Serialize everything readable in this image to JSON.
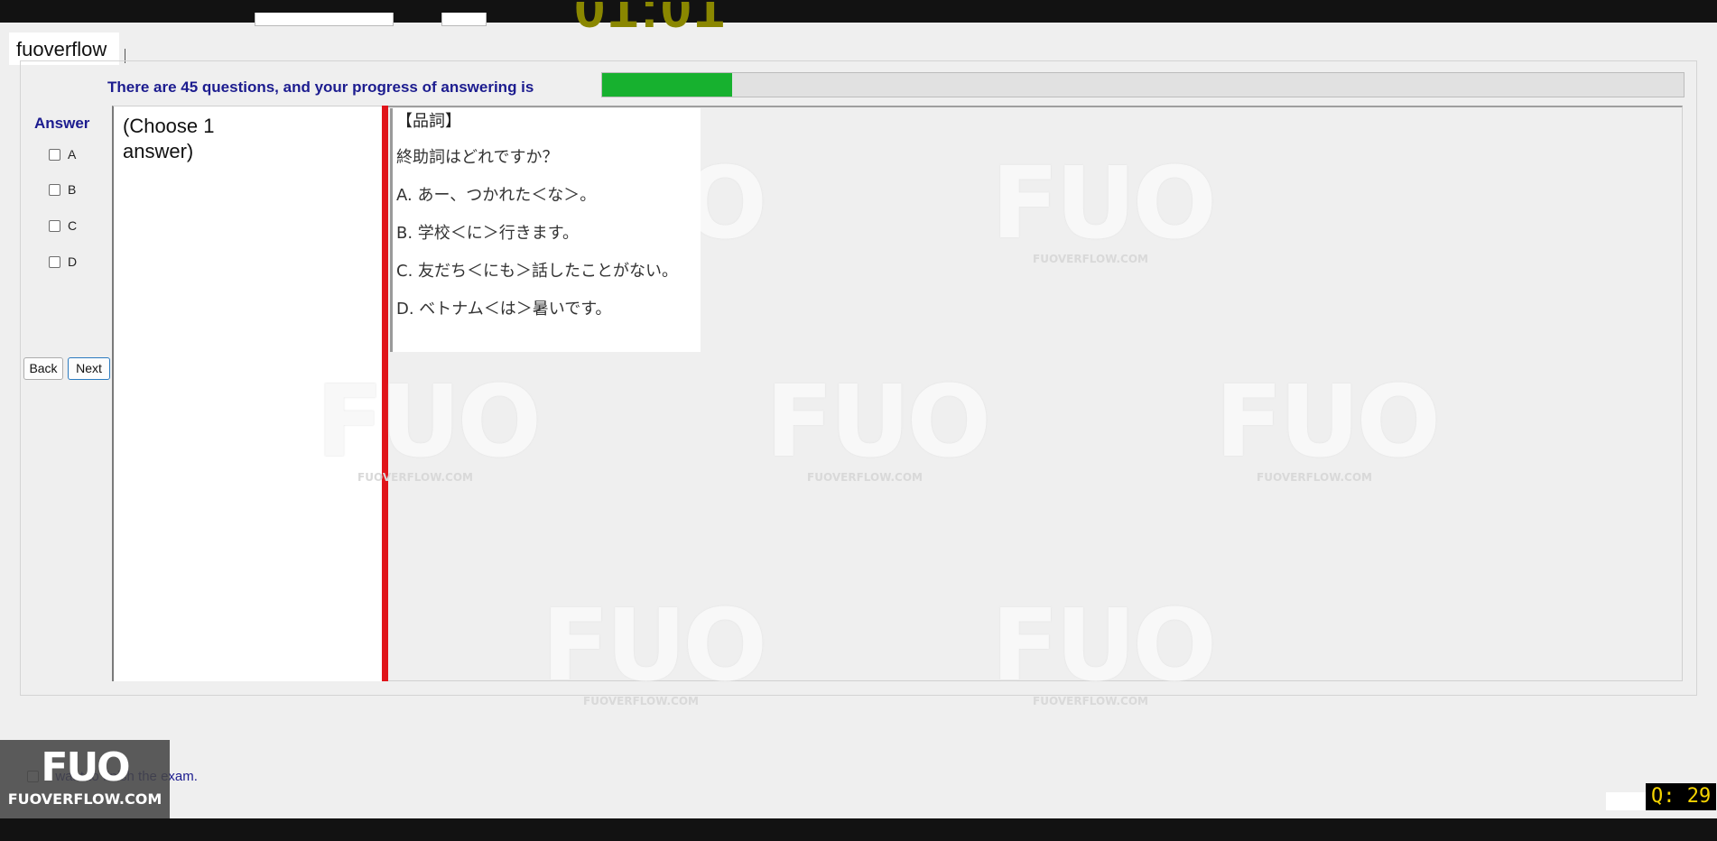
{
  "header": {
    "username": "fuoverflow"
  },
  "progress": {
    "text": "There are 45 questions, and your progress of answering is",
    "fraction": 0.12
  },
  "answer_panel": {
    "title": "Answer",
    "options": [
      "A",
      "B",
      "C",
      "D"
    ],
    "back_label": "Back",
    "next_label": "Next"
  },
  "choose_panel": {
    "text": "(Choose 1 answer)"
  },
  "question": {
    "tag": "【品詞】",
    "prompt": "終助詞はどれですか？",
    "options": [
      "A.  あー、つかれた＜な＞。",
      "B.  学校＜に＞行きます。",
      "C.  友だち＜にも＞話したことがない。",
      "D.  ベトナム＜は＞暑いです。"
    ]
  },
  "footer": {
    "finish_text": "I want to finish the exam.",
    "logo_big": "FUO",
    "logo_small": "FUOVERFLOW.COM",
    "q_counter": "Q: 29"
  },
  "watermark": {
    "big": "FUO",
    "small": "FUOVERFLOW.COM"
  },
  "colors": {
    "progress_fill": "#17b12f",
    "label_blue": "#1c1c8f",
    "divider_red": "#e0141a",
    "timer_olive": "#8a8700"
  }
}
